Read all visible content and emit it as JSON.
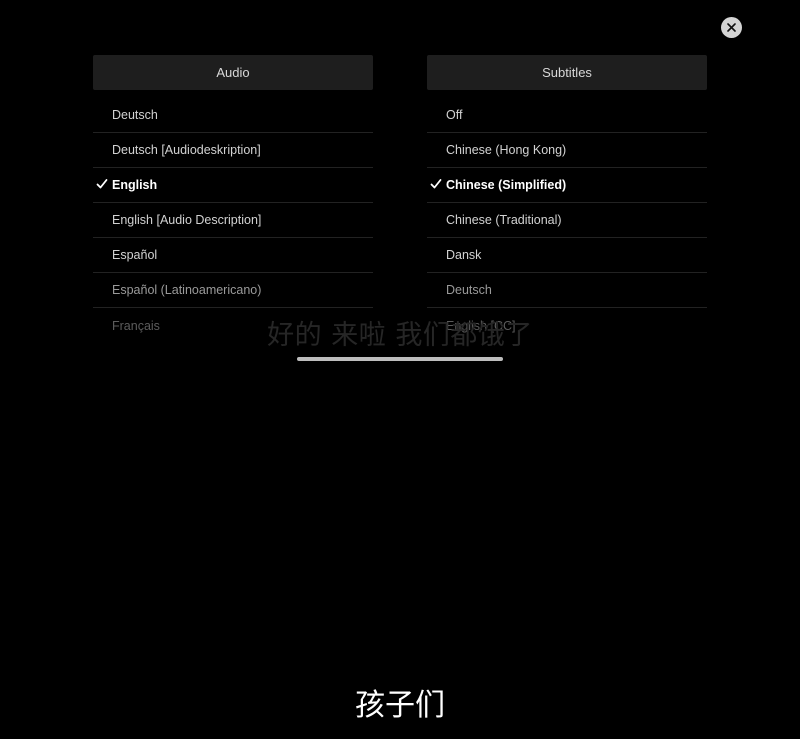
{
  "close": {
    "icon": "close-icon"
  },
  "audio": {
    "header": "Audio",
    "options": [
      {
        "label": "Deutsch",
        "selected": false
      },
      {
        "label": "Deutsch [Audiodeskription]",
        "selected": false
      },
      {
        "label": "English",
        "selected": true
      },
      {
        "label": "English [Audio Description]",
        "selected": false
      },
      {
        "label": "Español",
        "selected": false
      },
      {
        "label": "Español (Latinoamericano)",
        "selected": false
      },
      {
        "label": "Français",
        "selected": false
      }
    ]
  },
  "subtitles": {
    "header": "Subtitles",
    "options": [
      {
        "label": "Off",
        "selected": false
      },
      {
        "label": "Chinese (Hong Kong)",
        "selected": false
      },
      {
        "label": "Chinese (Simplified)",
        "selected": true
      },
      {
        "label": "Chinese (Traditional)",
        "selected": false
      },
      {
        "label": "Dansk",
        "selected": false
      },
      {
        "label": "Deutsch",
        "selected": false
      },
      {
        "label": "English [CC]",
        "selected": false
      }
    ]
  },
  "video": {
    "ghost_subtitle": "好的 来啦 我们都饿了",
    "subtitle": "孩子们"
  },
  "colors": {
    "background": "#000000",
    "header_bg": "#1e1e1e",
    "selected_text": "#ffffff",
    "close_bg": "#d4d4d4"
  }
}
